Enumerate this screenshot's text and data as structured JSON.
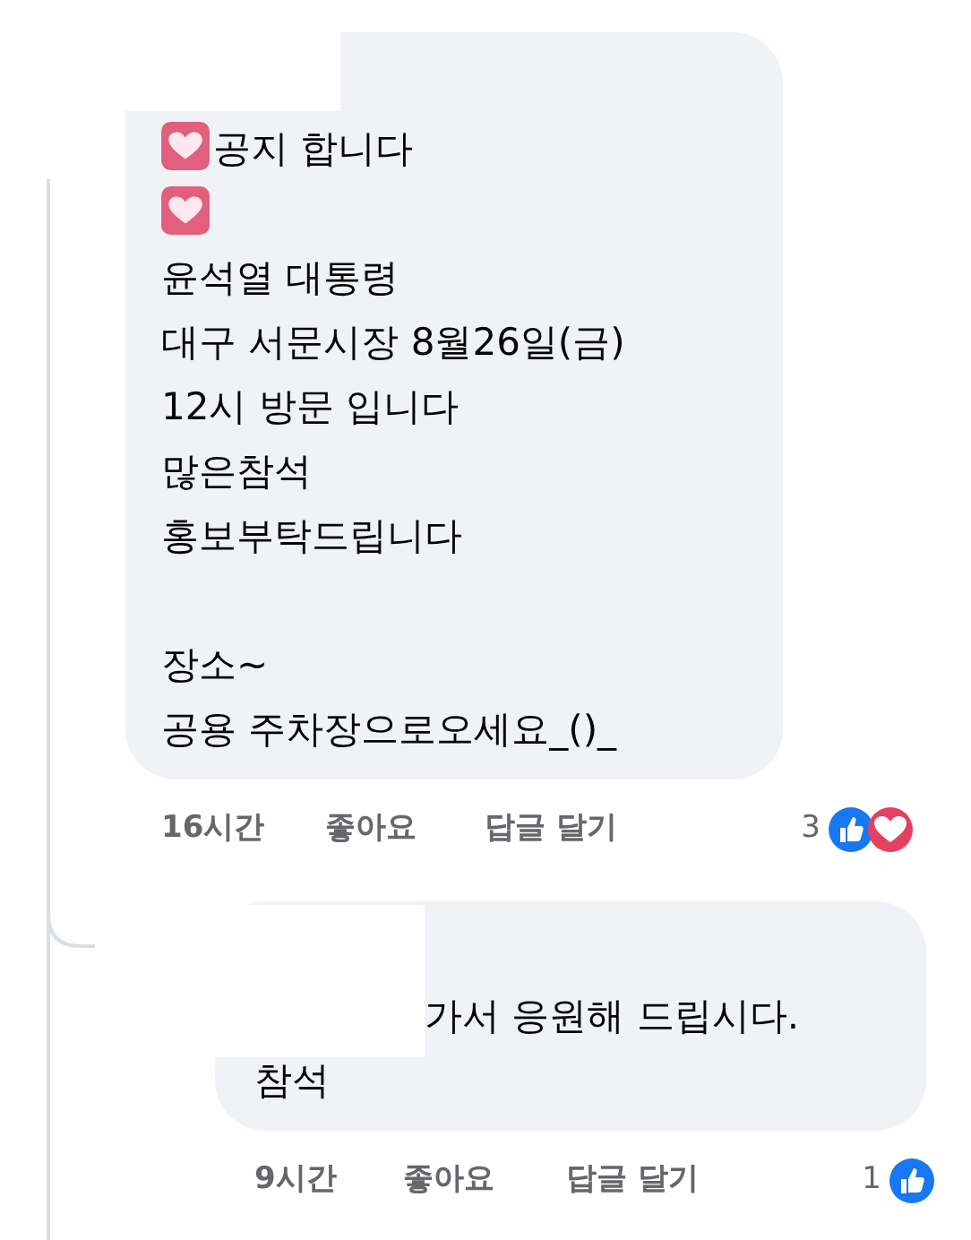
{
  "comments": [
    {
      "redacted": true,
      "paragraphs": [
        [
          {
            "emoji": true,
            "text": "공지 합니다"
          },
          {
            "emoji": true
          },
          {
            "text": "윤석열 대통령"
          },
          {
            "text": "대구 서문시장 8월26일(금)"
          },
          {
            "text": "12시 방문 입니다"
          },
          {
            "text": "많은참석"
          },
          {
            "text": "홍보부탁드립니다"
          }
        ],
        [
          {
            "text": "장소~"
          },
          {
            "text": "공용 주차장으로오세요_()_"
          }
        ]
      ],
      "time": "16시간",
      "like_label": "좋아요",
      "reply_label": "답글 달기",
      "reaction_count": "3",
      "reactions": [
        {
          "kind": "like"
        },
        {
          "kind": "love"
        }
      ]
    },
    {
      "redacted": true,
      "reply": true,
      "paragraphs": [
        [
          {
            "text": "가서 응원해 드립시다."
          },
          {
            "text": "참석"
          }
        ]
      ],
      "time": "9시간",
      "like_label": "좋아요",
      "reply_label": "답글 달기",
      "reaction_count": "1",
      "reactions": [
        {
          "kind": "like"
        }
      ]
    }
  ]
}
